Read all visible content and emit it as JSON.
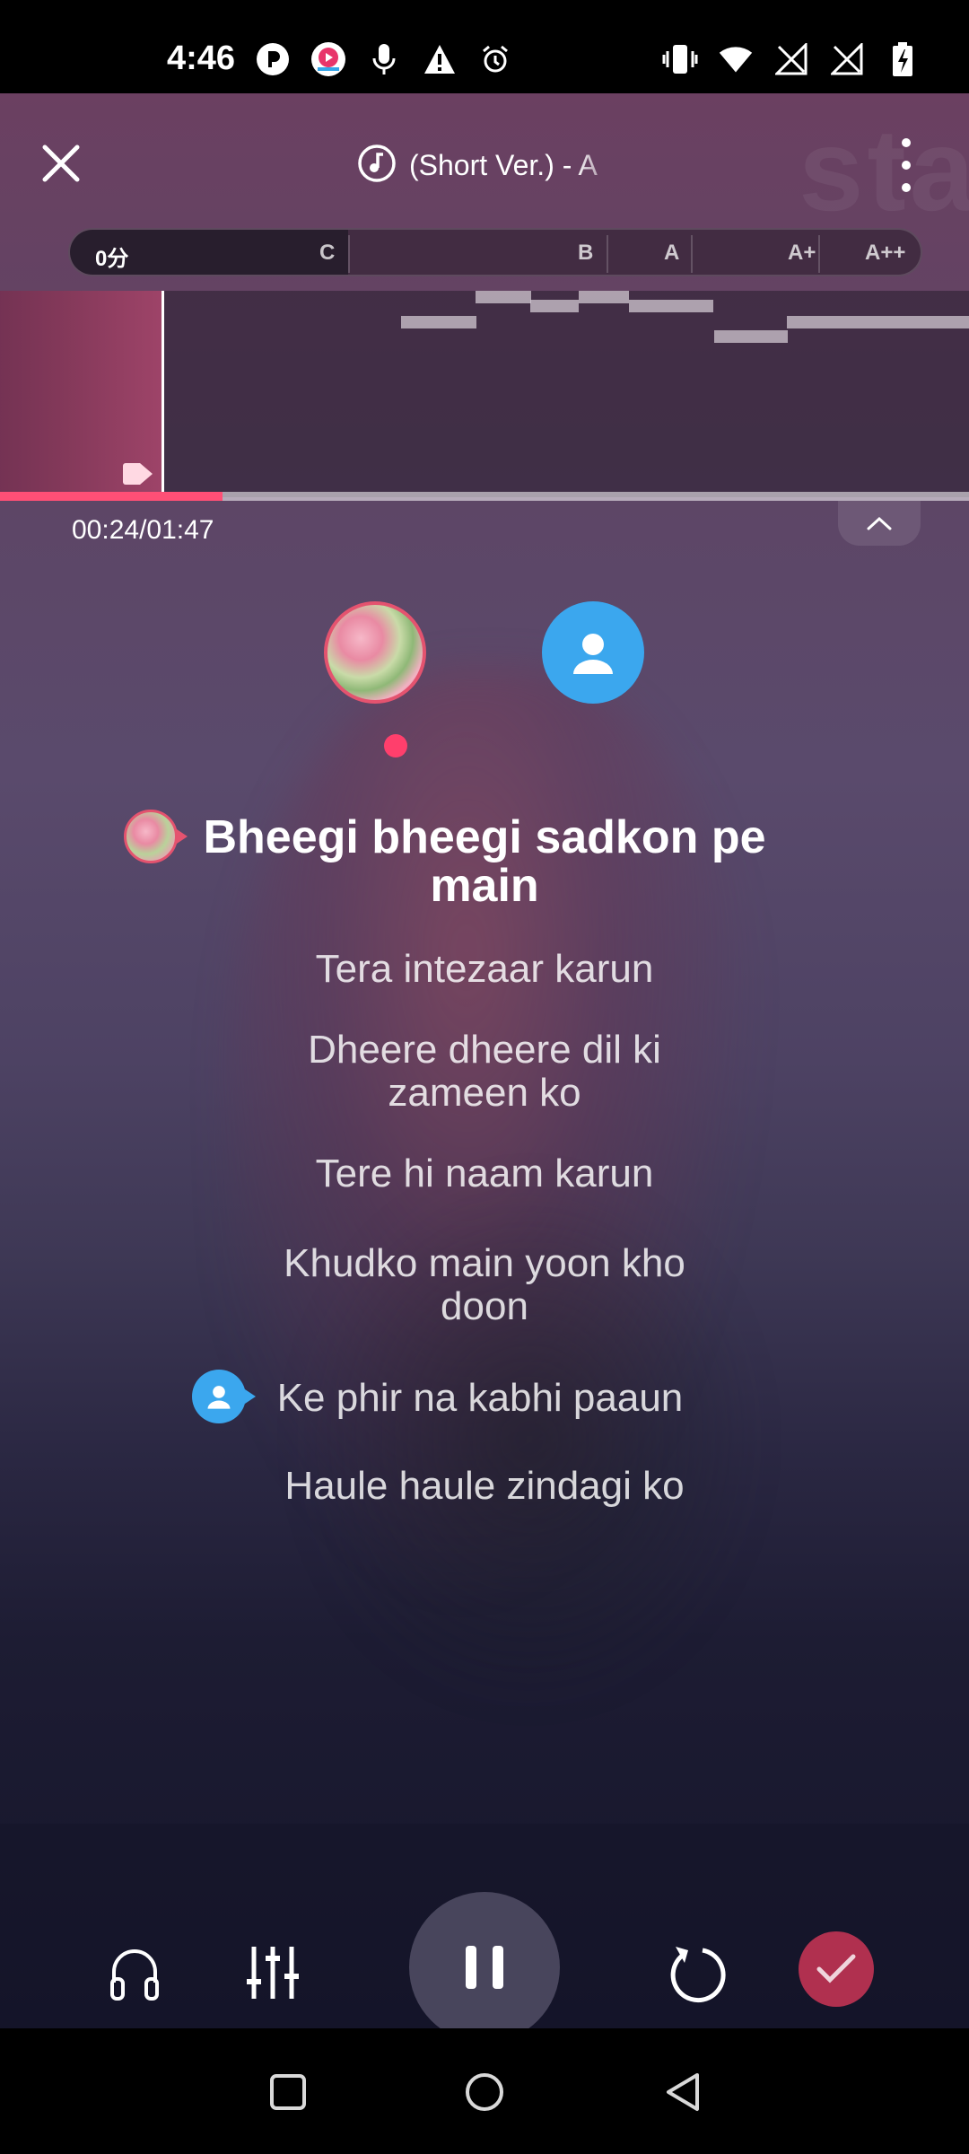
{
  "status_bar": {
    "time": "4:46",
    "left_icons": [
      "p-icon",
      "app-badge-icon",
      "microphone-icon",
      "warning-icon",
      "alarm-icon"
    ],
    "right_icons": [
      "vibrate-icon",
      "wifi-icon",
      "no-signal-icon",
      "no-signal-icon",
      "battery-charging-icon"
    ]
  },
  "header": {
    "title": "(Short Ver.) - A",
    "title_icon": "music-note-icon"
  },
  "score": {
    "current": "0分",
    "grades": [
      "C",
      "B",
      "A",
      "A+",
      "A++"
    ]
  },
  "playback": {
    "time": "00:24/01:47",
    "progress": 0.23
  },
  "lyrics": {
    "current": "Bheegi bheegi sadkon pe main",
    "lines": [
      "Tera intezaar karun",
      "Dheere dheere dil ki zameen ko",
      "Tere hi naam karun",
      "Khudko main yoon kho doon",
      "Ke phir na kabhi paaun",
      "Haule haule zindagi ko"
    ]
  },
  "controls": [
    "headphones-icon",
    "mixer-icon",
    "pause-icon",
    "restart-icon",
    "check-icon"
  ],
  "colors": {
    "accent": "#ff4f76",
    "user_blue": "#3ba7ee",
    "done": "#b0304f"
  }
}
